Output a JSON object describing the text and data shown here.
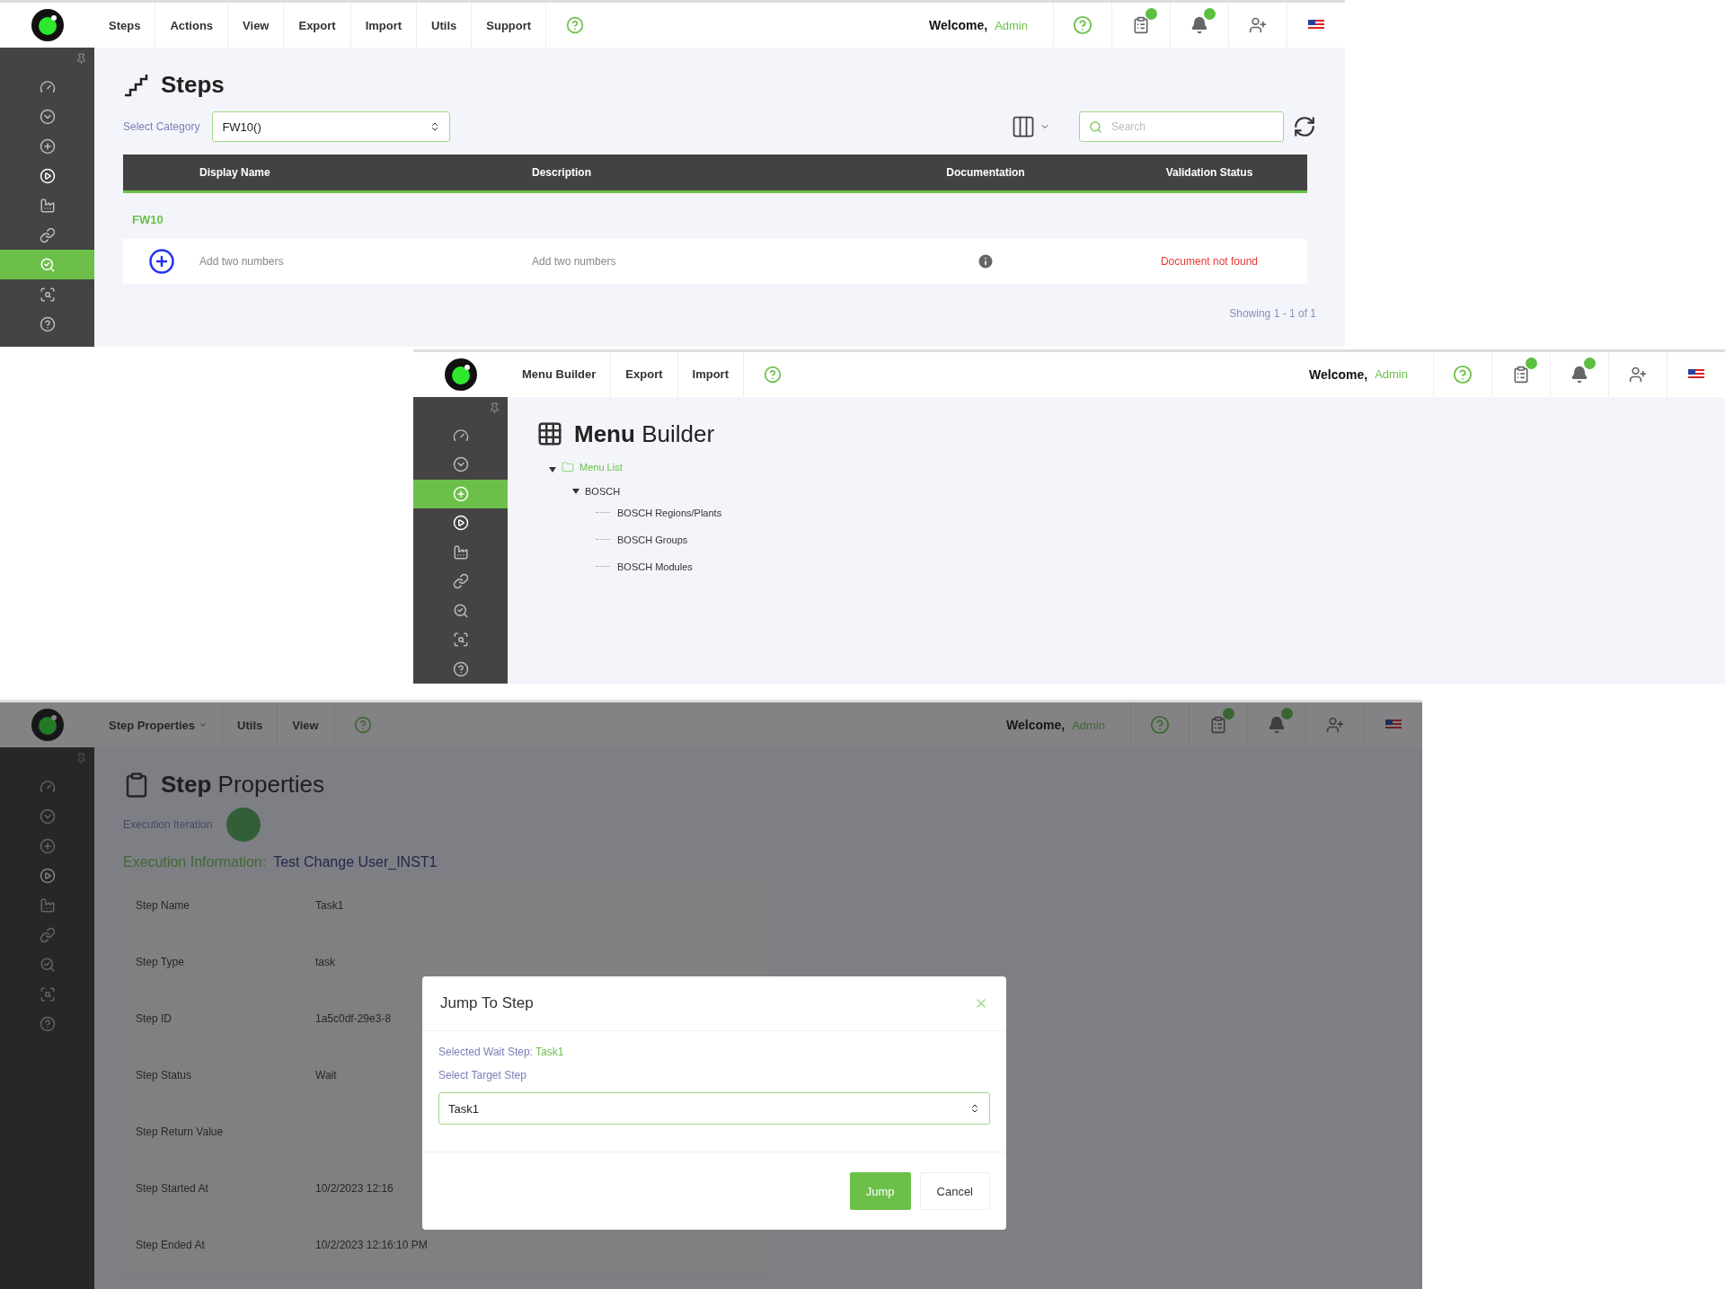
{
  "screens": [
    {
      "kind": "steps",
      "menu": [
        {
          "label": "Steps",
          "dropdown": false
        },
        {
          "label": "Actions",
          "dropdown": false
        },
        {
          "label": "View",
          "dropdown": false
        },
        {
          "label": "Export",
          "dropdown": false
        },
        {
          "label": "Import",
          "dropdown": false
        },
        {
          "label": "Utils",
          "dropdown": false
        },
        {
          "label": "Support",
          "dropdown": false
        }
      ],
      "welcome": "Welcome,",
      "user": "Admin",
      "sidebar": [
        {
          "selected": false
        },
        {
          "selected": false
        },
        {
          "selected": false
        },
        {
          "selected": false
        },
        {
          "selected": false
        },
        {
          "selected": false
        },
        {
          "selected": true
        },
        {
          "selected": false
        },
        {
          "selected": false
        }
      ],
      "title": "Steps",
      "category_label": "Select Category",
      "category_value": "FW10()",
      "search_placeholder": "Search",
      "columns": [
        "Display Name",
        "Description",
        "Documentation",
        "Validation Status"
      ],
      "groups": [
        {
          "name": "FW10",
          "rows": [
            {
              "display_name": "Add two numbers",
              "description": "Add two numbers",
              "validation_status": "Document not found"
            }
          ]
        }
      ],
      "footer": "Showing 1 - 1 of 1"
    },
    {
      "kind": "menu_builder",
      "menu": [
        {
          "label": "Menu Builder",
          "dropdown": false
        },
        {
          "label": "Export",
          "dropdown": false
        },
        {
          "label": "Import",
          "dropdown": false
        }
      ],
      "welcome": "Welcome,",
      "user": "Admin",
      "sidebar": [
        {
          "selected": false
        },
        {
          "selected": false
        },
        {
          "selected": true
        },
        {
          "selected": false
        },
        {
          "selected": false
        },
        {
          "selected": false
        },
        {
          "selected": false
        },
        {
          "selected": false
        },
        {
          "selected": false
        }
      ],
      "title_bold": "Menu",
      "title_rest": "Builder",
      "tree": [
        {
          "label": "Menu List",
          "children": [
            {
              "label": "BOSCH",
              "children": [
                {
                  "label": "BOSCH Regions/Plants"
                },
                {
                  "label": "BOSCH Groups"
                },
                {
                  "label": "BOSCH Modules"
                }
              ]
            }
          ]
        }
      ]
    },
    {
      "kind": "step_properties",
      "menu": [
        {
          "label": "Step Properties",
          "dropdown": true
        },
        {
          "label": "Utils",
          "dropdown": false
        },
        {
          "label": "View",
          "dropdown": false
        }
      ],
      "welcome": "Welcome,",
      "user": "Admin",
      "sidebar": [
        {
          "selected": false
        },
        {
          "selected": false
        },
        {
          "selected": false
        },
        {
          "selected": false
        },
        {
          "selected": false
        },
        {
          "selected": false
        },
        {
          "selected": false
        },
        {
          "selected": false
        },
        {
          "selected": false
        }
      ],
      "title_bold": "Step",
      "title_rest": "Properties",
      "iteration_label": "Execution Iteration",
      "info_label": "Execution Information:",
      "info_value": "Test Change User_INST1",
      "properties": [
        {
          "label": "Step Name",
          "value": "Task1"
        },
        {
          "label": "Step Type",
          "value": "task"
        },
        {
          "label": "Step ID",
          "value": "1a5c0df-29e3-8"
        },
        {
          "label": "Step Status",
          "value": "Wait"
        },
        {
          "label": "Step Return Value"
        },
        {
          "label": "Step Started At",
          "value": "10/2/2023 12:16"
        },
        {
          "label": "Step Ended At",
          "value": "10/2/2023 12:16:10 PM"
        }
      ],
      "dialog": {
        "title": "Jump To Step",
        "selected_label": "Selected Wait Step:",
        "selected_value": "Task1",
        "target_label": "Select Target Step",
        "target_value": "Task1",
        "buttons": [
          "Jump",
          "Cancel"
        ]
      }
    }
  ]
}
